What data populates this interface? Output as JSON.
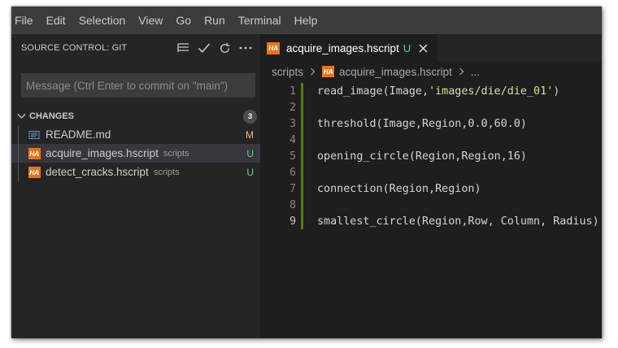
{
  "menu": [
    "File",
    "Edit",
    "Selection",
    "View",
    "Go",
    "Run",
    "Terminal",
    "Help"
  ],
  "sidebar": {
    "title": "SOURCE CONTROL: GIT",
    "message_placeholder": "Message (Ctrl Enter to commit on \"main\")",
    "changes_label": "CHANGES",
    "changes_count": "3",
    "files": [
      {
        "name": "README.md",
        "desc": "",
        "status": "M",
        "icon": "markdown-icon",
        "status_color": "#e2c08d"
      },
      {
        "name": "acquire_images.hscript",
        "desc": "scripts",
        "status": "U",
        "icon": "ha-icon",
        "status_color": "#73c991"
      },
      {
        "name": "detect_cracks.hscript",
        "desc": "scripts",
        "status": "U",
        "icon": "ha-icon",
        "status_color": "#73c991"
      }
    ]
  },
  "editor": {
    "tab": {
      "label": "acquire_images.hscript",
      "status": "U",
      "icon_text": "HA"
    },
    "breadcrumb": {
      "folder": "scripts",
      "file": "acquire_images.hscript",
      "more": "..."
    },
    "lines": [
      {
        "num": "1",
        "pre": "read_image(Image,",
        "str": "'images/die/die_01'",
        "post": ")"
      },
      {
        "num": "2",
        "pre": "",
        "str": "",
        "post": ""
      },
      {
        "num": "3",
        "pre": "threshold(Image,Region,0.0,60.0)",
        "str": "",
        "post": ""
      },
      {
        "num": "4",
        "pre": "",
        "str": "",
        "post": ""
      },
      {
        "num": "5",
        "pre": "opening_circle(Region,Region,16)",
        "str": "",
        "post": ""
      },
      {
        "num": "6",
        "pre": "",
        "str": "",
        "post": ""
      },
      {
        "num": "7",
        "pre": "connection(Region,Region)",
        "str": "",
        "post": ""
      },
      {
        "num": "8",
        "pre": "",
        "str": "",
        "post": ""
      },
      {
        "num": "9",
        "pre": "smallest_circle(Region,Row, Column, Radius)",
        "str": "",
        "post": ""
      }
    ]
  },
  "colors": {
    "untracked": "#73c991",
    "modified": "#e2c08d",
    "ha_badge": "#e8741a",
    "gutter_added": "#587c0c"
  }
}
